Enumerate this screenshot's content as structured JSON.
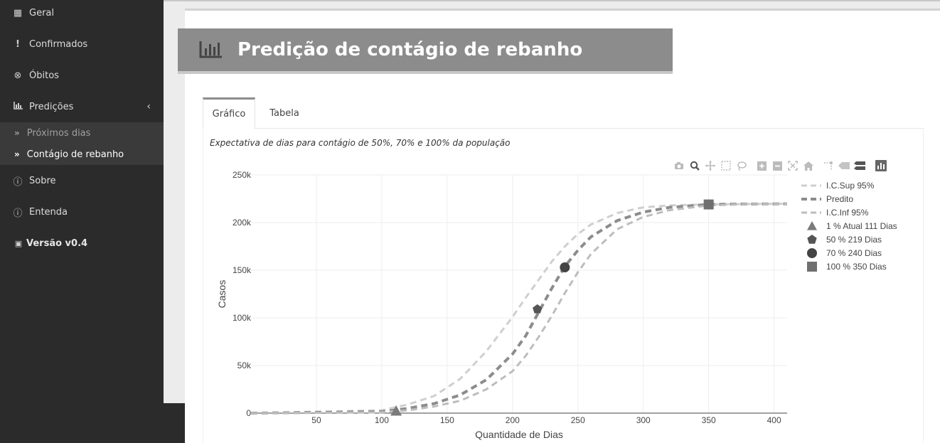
{
  "sidebar": {
    "items": [
      {
        "label": "Geral",
        "icon": "dashboard-icon"
      },
      {
        "label": "Confirmados",
        "icon": "exclamation-icon"
      },
      {
        "label": "Óbitos",
        "icon": "times-circle-icon"
      },
      {
        "label": "Predições",
        "icon": "bar-chart-icon"
      }
    ],
    "subitems": [
      {
        "label": "Próximos dias",
        "icon": "double-chevron-icon"
      },
      {
        "label": "Contágio de rebanho",
        "icon": "double-chevron-icon"
      }
    ],
    "bottom_items": [
      {
        "label": "Sobre",
        "icon": "info-icon"
      },
      {
        "label": "Entenda",
        "icon": "info-icon"
      }
    ],
    "version": "Versão v0.4"
  },
  "header": {
    "title": "Predição de contágio de rebanho"
  },
  "tabs": [
    {
      "label": "Gráfico",
      "active": true
    },
    {
      "label": "Tabela",
      "active": false
    }
  ],
  "subtitle": "Expectativa de dias para contágio de 50%, 70% e 100% da população",
  "chart_data": {
    "type": "line",
    "title": "",
    "xlabel": "Quantidade de Dias",
    "ylabel": "Casos",
    "xlim": [
      0,
      410
    ],
    "ylim": [
      0,
      250000
    ],
    "xticks": [
      50,
      100,
      150,
      200,
      250,
      300,
      350,
      400
    ],
    "xtick_labels": [
      "50",
      "100",
      "150",
      "200",
      "250",
      "300",
      "350",
      "400"
    ],
    "yticks": [
      0,
      50000,
      100000,
      150000,
      200000,
      250000
    ],
    "ytick_labels": [
      "0",
      "50k",
      "100k",
      "150k",
      "200k",
      "250k"
    ],
    "grid": true,
    "legend_position": "right",
    "series": [
      {
        "name": "I.C.Sup 95%",
        "style": "dash",
        "color": "#cfcfcf",
        "x": [
          0,
          100,
          120,
          140,
          160,
          180,
          200,
          210,
          220,
          230,
          240,
          250,
          260,
          280,
          300,
          320,
          350,
          380,
          410
        ],
        "y": [
          0,
          3000,
          9000,
          18000,
          36000,
          65000,
          101000,
          121000,
          140000,
          159000,
          175000,
          188000,
          198000,
          210000,
          216000,
          218000,
          219000,
          219500,
          219700
        ]
      },
      {
        "name": "Predito",
        "style": "dash",
        "color": "#8c8c8c",
        "x": [
          0,
          100,
          120,
          140,
          160,
          180,
          200,
          210,
          220,
          230,
          240,
          250,
          260,
          280,
          300,
          320,
          350,
          380,
          410
        ],
        "y": [
          0,
          1500,
          5000,
          10000,
          19000,
          35000,
          62000,
          81000,
          106000,
          131000,
          154000,
          171000,
          185000,
          202000,
          211000,
          216000,
          219000,
          219500,
          219700
        ]
      },
      {
        "name": "I.C.Inf 95%",
        "style": "dash",
        "color": "#bdbdbd",
        "x": [
          0,
          100,
          120,
          140,
          160,
          180,
          200,
          210,
          220,
          230,
          240,
          250,
          260,
          280,
          300,
          320,
          350,
          380,
          410
        ],
        "y": [
          0,
          800,
          3000,
          7000,
          13000,
          25000,
          44000,
          60000,
          80000,
          102000,
          126000,
          148000,
          167000,
          193000,
          206000,
          213000,
          218000,
          219500,
          219700
        ]
      }
    ],
    "markers": [
      {
        "name": "1 % Atual 111 Dias",
        "symbol": "triangle",
        "x": 111,
        "y": 2200,
        "color": "#7a7a7a"
      },
      {
        "name": "50 % 219 Dias",
        "symbol": "pentagon",
        "x": 219,
        "y": 109000,
        "color": "#555555"
      },
      {
        "name": "70 % 240 Dias",
        "symbol": "circle",
        "x": 240,
        "y": 153000,
        "color": "#444444"
      },
      {
        "name": "100 % 350 Dias",
        "symbol": "square",
        "x": 350,
        "y": 219000,
        "color": "#6f6f6f"
      }
    ]
  },
  "modebar_icons": [
    "camera-icon",
    "zoom-icon",
    "pan-icon",
    "box-select-icon",
    "lasso-icon",
    "zoom-in-icon",
    "zoom-out-icon",
    "autoscale-icon",
    "home-icon",
    "spike-icon",
    "hover-closest-icon",
    "hover-compare-icon",
    "plotly-logo-icon"
  ]
}
